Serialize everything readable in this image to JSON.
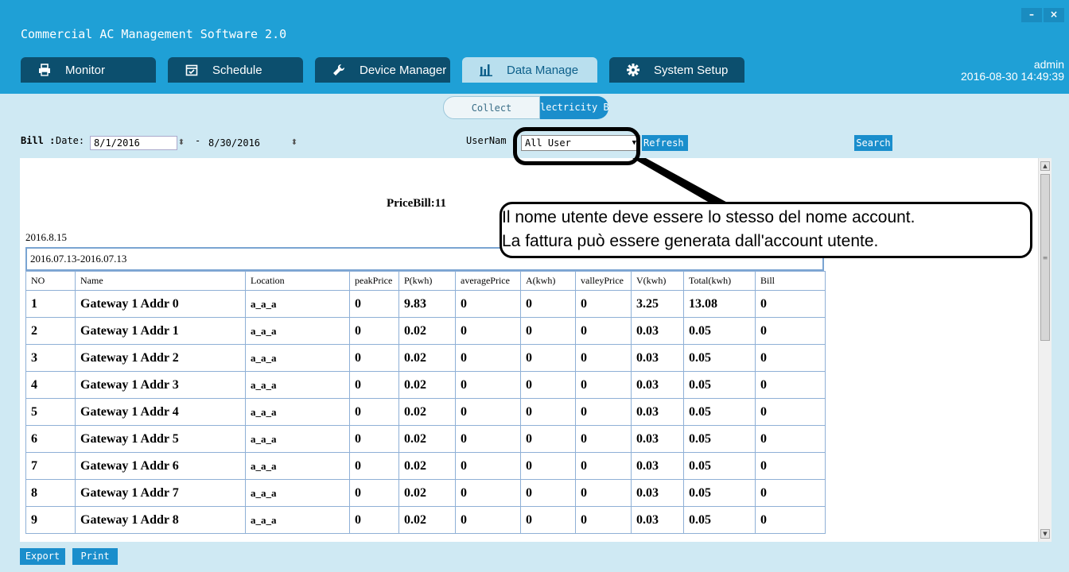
{
  "app": {
    "title": "Commercial AC Management Software 2.0",
    "window_controls": [
      "–",
      "×"
    ]
  },
  "user": {
    "name": "admin",
    "datetime": "2016-08-30 14:49:39"
  },
  "tabs": [
    {
      "label": "Monitor",
      "icon": "printer-icon",
      "active": false
    },
    {
      "label": "Schedule",
      "icon": "calendar-icon",
      "active": false
    },
    {
      "label": "Device Manager",
      "icon": "wrench-icon",
      "active": false
    },
    {
      "label": "Data Manage",
      "icon": "bar-chart-icon",
      "active": true
    },
    {
      "label": "System Setup",
      "icon": "gear-icon",
      "active": false
    }
  ],
  "subtabs": {
    "collect": "Collect",
    "electricity_bill": "lectricity Bil"
  },
  "filter": {
    "bill_label": "Bill :",
    "date_label": "Date:",
    "start_date": "8/1/2016",
    "separator": "-",
    "end_date": "8/30/2016",
    "username_label": "UserNam",
    "user_select": "All User",
    "refresh_label": "Refresh",
    "search_label": "Search"
  },
  "report": {
    "title": "PriceBill:11",
    "date": "2016.8.15",
    "period": "2016.07.13-2016.07.13",
    "columns": [
      "NO",
      "Name",
      "Location",
      "peakPrice",
      "P(kwh)",
      "averagePrice",
      "A(kwh)",
      "valleyPrice",
      "V(kwh)",
      "Total(kwh)",
      "Bill"
    ],
    "rows": [
      [
        "1",
        "Gateway 1 Addr 0",
        "a_a_a",
        "0",
        "9.83",
        "0",
        "0",
        "0",
        "3.25",
        "13.08",
        "0"
      ],
      [
        "2",
        "Gateway 1 Addr 1",
        "a_a_a",
        "0",
        "0.02",
        "0",
        "0",
        "0",
        "0.03",
        "0.05",
        "0"
      ],
      [
        "3",
        "Gateway 1 Addr 2",
        "a_a_a",
        "0",
        "0.02",
        "0",
        "0",
        "0",
        "0.03",
        "0.05",
        "0"
      ],
      [
        "4",
        "Gateway 1 Addr 3",
        "a_a_a",
        "0",
        "0.02",
        "0",
        "0",
        "0",
        "0.03",
        "0.05",
        "0"
      ],
      [
        "5",
        "Gateway 1 Addr 4",
        "a_a_a",
        "0",
        "0.02",
        "0",
        "0",
        "0",
        "0.03",
        "0.05",
        "0"
      ],
      [
        "6",
        "Gateway 1 Addr 5",
        "a_a_a",
        "0",
        "0.02",
        "0",
        "0",
        "0",
        "0.03",
        "0.05",
        "0"
      ],
      [
        "7",
        "Gateway 1 Addr 6",
        "a_a_a",
        "0",
        "0.02",
        "0",
        "0",
        "0",
        "0.03",
        "0.05",
        "0"
      ],
      [
        "8",
        "Gateway 1 Addr 7",
        "a_a_a",
        "0",
        "0.02",
        "0",
        "0",
        "0",
        "0.03",
        "0.05",
        "0"
      ],
      [
        "9",
        "Gateway 1 Addr 8",
        "a_a_a",
        "0",
        "0.02",
        "0",
        "0",
        "0",
        "0.03",
        "0.05",
        "0"
      ]
    ]
  },
  "footer": {
    "export_label": "Export",
    "print_label": "Print"
  },
  "callout": {
    "line1": "Il nome utente deve essere lo stesso del nome account.",
    "line2": "La fattura può essere generata dall'account utente."
  },
  "colors": {
    "titlebar": "#1fa0d6",
    "tab_bg": "#0c4f6e",
    "accent": "#1a8ecc",
    "background": "#cfe9f3"
  }
}
